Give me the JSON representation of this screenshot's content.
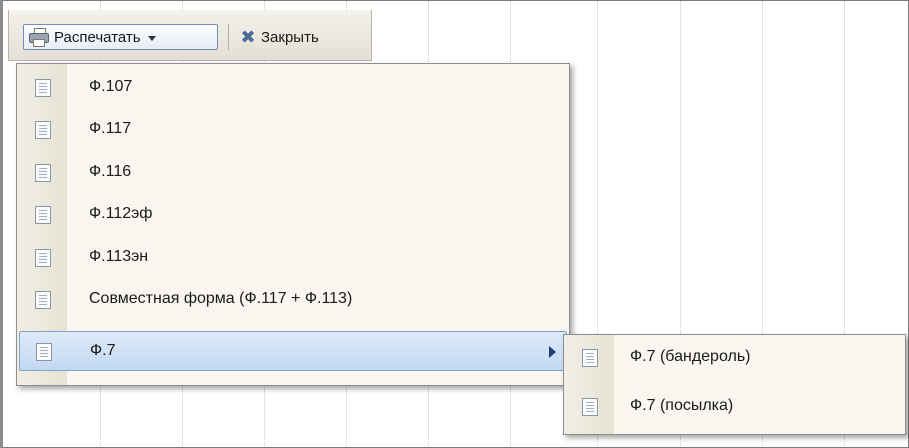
{
  "toolbar": {
    "print_label": "Распечатать",
    "close_label": "Закрыть"
  },
  "menu": {
    "items": [
      {
        "label": "Ф.107"
      },
      {
        "label": "Ф.117"
      },
      {
        "label": "Ф.116"
      },
      {
        "label": "Ф.112эф"
      },
      {
        "label": "Ф.113эн"
      },
      {
        "label": "Совместная форма (Ф.117 + Ф.113)"
      },
      {
        "label": "Ф.7"
      }
    ]
  },
  "submenu": {
    "items": [
      {
        "label": "Ф.7 (бандероль)"
      },
      {
        "label": "Ф.7 (посылка)"
      }
    ]
  },
  "icons": {
    "print": "printer-icon",
    "close": "close-icon",
    "menu_item": "document-icon",
    "submenu": "chevron-right-icon"
  },
  "colors": {
    "accent_border": "#7da2ce",
    "active_item": "#c3d9f1",
    "menu_bg": "#f8f6ee",
    "close_x": "#4a6b99"
  }
}
